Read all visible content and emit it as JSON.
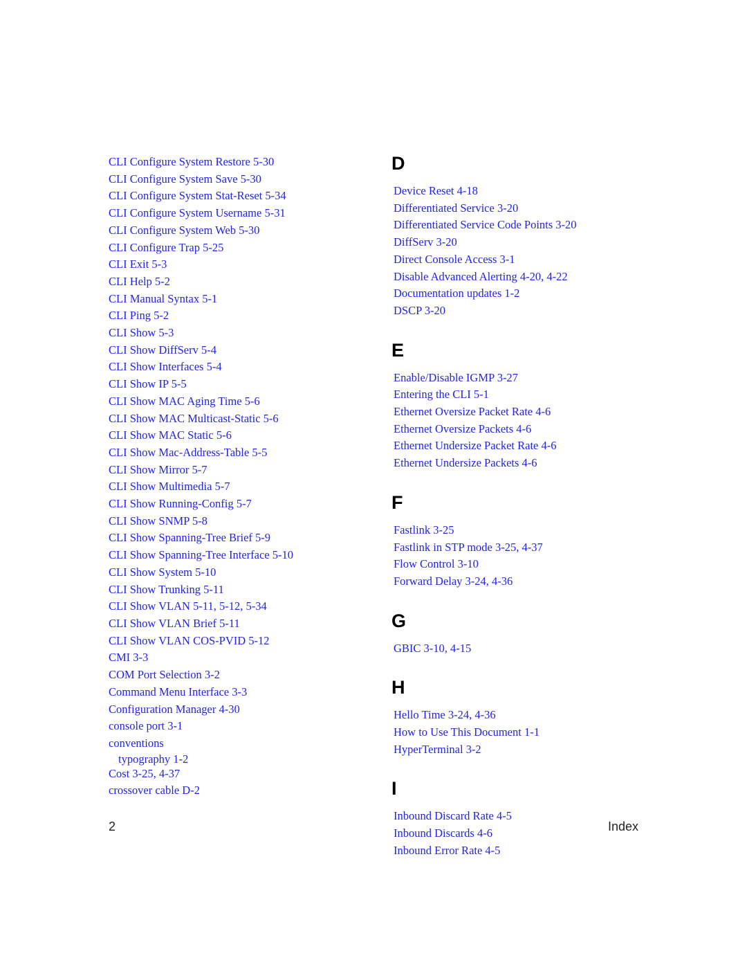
{
  "document": {
    "type": "index",
    "accent_color": "#2222ee",
    "header_color": "#000000",
    "footer_color": "#231f20"
  },
  "footer": {
    "page_number": "2",
    "label": "Index"
  },
  "left_column": {
    "entries": [
      {
        "text": "CLI Configure System Restore  5-30"
      },
      {
        "text": "CLI Configure System Save  5-30"
      },
      {
        "text": "CLI Configure System Stat-Reset  5-34"
      },
      {
        "text": "CLI Configure System Username  5-31"
      },
      {
        "text": "CLI Configure System Web  5-30"
      },
      {
        "text": "CLI Configure Trap  5-25"
      },
      {
        "text": "CLI Exit  5-3"
      },
      {
        "text": "CLI Help  5-2"
      },
      {
        "text": "CLI Manual Syntax  5-1"
      },
      {
        "text": "CLI Ping  5-2"
      },
      {
        "text": "CLI Show  5-3"
      },
      {
        "text": "CLI Show DiffServ  5-4"
      },
      {
        "text": "CLI Show Interfaces  5-4"
      },
      {
        "text": "CLI Show IP  5-5"
      },
      {
        "text": "CLI Show MAC Aging Time  5-6"
      },
      {
        "text": "CLI Show MAC Multicast-Static  5-6"
      },
      {
        "text": "CLI Show MAC Static  5-6"
      },
      {
        "text": "CLI Show Mac-Address-Table  5-5"
      },
      {
        "text": "CLI Show Mirror  5-7"
      },
      {
        "text": "CLI Show Multimedia  5-7"
      },
      {
        "text": "CLI Show Running-Config  5-7"
      },
      {
        "text": "CLI Show SNMP  5-8"
      },
      {
        "text": "CLI Show Spanning-Tree Brief  5-9"
      },
      {
        "text": "CLI Show Spanning-Tree Interface  5-10"
      },
      {
        "text": "CLI Show System  5-10"
      },
      {
        "text": "CLI Show Trunking  5-11"
      },
      {
        "text": "CLI Show VLAN  5-11, 5-12, 5-34"
      },
      {
        "text": "CLI Show VLAN Brief  5-11"
      },
      {
        "text": "CLI Show VLAN COS-PVID  5-12"
      },
      {
        "text": "CMI  3-3"
      },
      {
        "text": "COM Port Selection  3-2"
      },
      {
        "text": "Command Menu Interface  3-3"
      },
      {
        "text": "Configuration Manager  4-30"
      },
      {
        "text": "console port  3-1"
      },
      {
        "text": "conventions"
      },
      {
        "text": "typography  1-2",
        "sub": true
      },
      {
        "text": "Cost  3-25, 4-37"
      },
      {
        "text": "crossover cable  D-2"
      }
    ]
  },
  "right_column": {
    "sections": [
      {
        "letter": "D",
        "entries": [
          {
            "text": "Device Reset  4-18"
          },
          {
            "text": "Differentiated Service  3-20"
          },
          {
            "text": "Differentiated Service Code Points  3-20"
          },
          {
            "text": "DiffServ  3-20"
          },
          {
            "text": "Direct Console Access  3-1"
          },
          {
            "text": "Disable Advanced Alerting  4-20, 4-22"
          },
          {
            "text": "Documentation updates  1-2"
          },
          {
            "text": "DSCP  3-20"
          }
        ]
      },
      {
        "letter": "E",
        "entries": [
          {
            "text": "Enable/Disable IGMP  3-27"
          },
          {
            "text": "Entering the CLI  5-1"
          },
          {
            "text": "Ethernet Oversize Packet Rate  4-6"
          },
          {
            "text": "Ethernet Oversize Packets  4-6"
          },
          {
            "text": "Ethernet Undersize Packet Rate  4-6"
          },
          {
            "text": "Ethernet Undersize Packets  4-6"
          }
        ]
      },
      {
        "letter": "F",
        "entries": [
          {
            "text": "Fastlink  3-25"
          },
          {
            "text": "Fastlink in STP mode  3-25, 4-37"
          },
          {
            "text": "Flow Control  3-10"
          },
          {
            "text": "Forward Delay  3-24, 4-36"
          }
        ]
      },
      {
        "letter": "G",
        "entries": [
          {
            "text": "GBIC  3-10, 4-15"
          }
        ]
      },
      {
        "letter": "H",
        "entries": [
          {
            "text": "Hello Time  3-24, 4-36"
          },
          {
            "text": "How to Use This Document  1-1"
          },
          {
            "text": "HyperTerminal  3-2"
          }
        ]
      },
      {
        "letter": "I",
        "entries": [
          {
            "text": "Inbound Discard Rate  4-5"
          },
          {
            "text": "Inbound Discards  4-6"
          },
          {
            "text": "Inbound Error Rate  4-5"
          }
        ]
      }
    ]
  }
}
